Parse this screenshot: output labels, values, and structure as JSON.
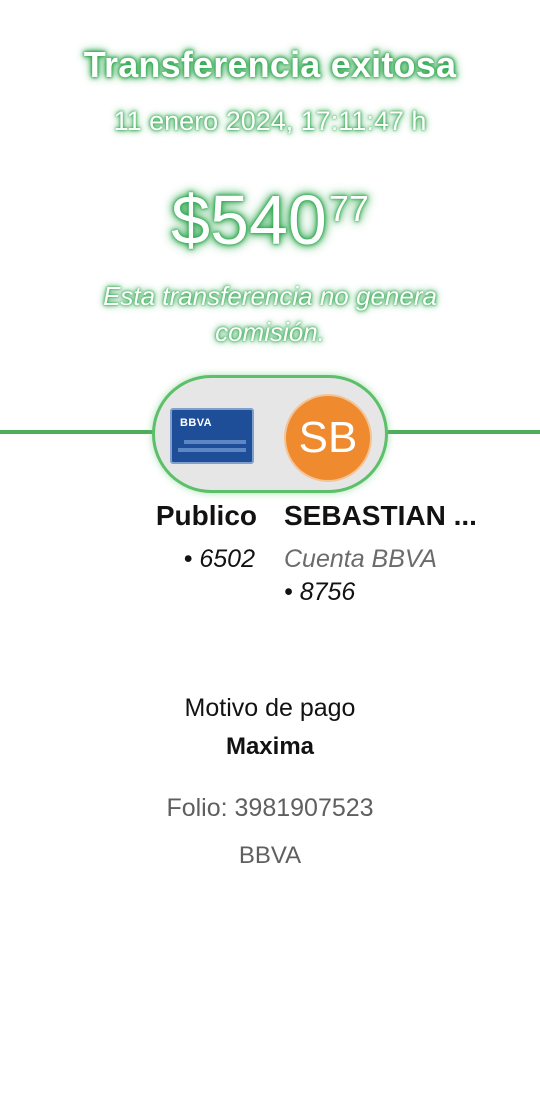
{
  "header": {
    "title": "Transferencia exitosa",
    "datetime": "11 enero 2024, 17:11:47 h"
  },
  "amount": {
    "main": "$540",
    "cents": "77"
  },
  "commission_text": "Esta transferencia no genera comisión.",
  "transfer": {
    "from": {
      "card_brand": "BBVA",
      "name": "Publico",
      "account_suffix": "• 6502"
    },
    "to": {
      "initials": "SB",
      "name": "SEBASTIAN ...",
      "bank_label": "Cuenta BBVA",
      "account_suffix": "• 8756"
    }
  },
  "payment": {
    "reason_label": "Motivo de pago",
    "reason_value": "Maxima",
    "folio": "Folio: 3981907523",
    "bank": "BBVA"
  },
  "colors": {
    "accent_green": "#4cae5a",
    "avatar_orange": "#ef8a2f",
    "card_blue": "#1f4e99"
  },
  "icons": {
    "card": "bank-card-icon",
    "avatar": "recipient-avatar-icon"
  }
}
